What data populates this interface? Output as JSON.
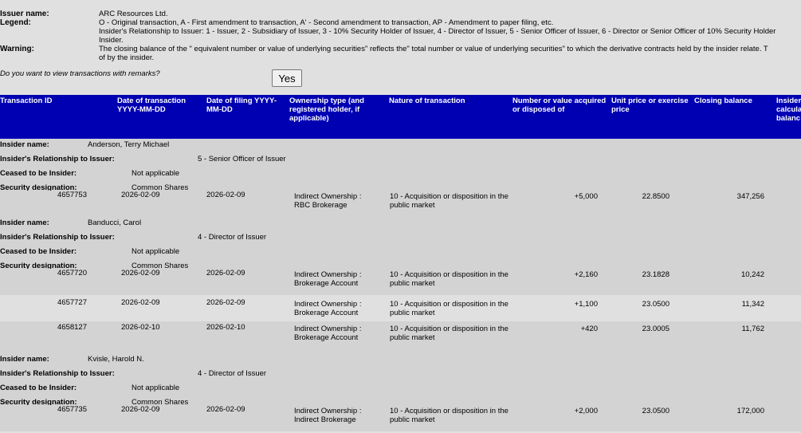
{
  "header": {
    "issuer_label": "Issuer name:",
    "issuer_value": "ARC Resources Ltd.",
    "legend_label": "Legend:",
    "legend_line1": "O - Original transaction, A - First amendment to transaction, A' - Second amendment to transaction, AP - Amendment to paper filing, etc.",
    "legend_line2": "Insider's Relationship to Issuer: 1 - Issuer, 2 - Subsidiary of Issuer, 3 - 10% Security Holder of Issuer, 4 - Director of Issuer, 5 - Senior Officer of Issuer, 6 - Director or Senior Officer of 10% Security Holder",
    "legend_line3": "Insider.",
    "warning_label": "Warning:",
    "warning_line1": "The closing balance of the \" equivalent number or value of underlying securities\" reflects the\" total number or value of underlying securities\" to which the derivative contracts held by the insider relate. T",
    "warning_line2": "of by the insider.",
    "remarks_question": "Do you want to view transactions with remarks?",
    "yes_button": "Yes"
  },
  "columns": [
    "Transaction ID",
    "Date of transaction YYYY-MM-DD",
    "Date of filing YYYY-MM-DD",
    "Ownership type (and registered holder, if applicable)",
    "Nature of transaction",
    "Number or value acquired or disposed of",
    "Unit price or exercise price",
    "Closing balance",
    "Insider calcula balanc"
  ],
  "labels": {
    "insider_name": "Insider name:",
    "relationship": "Insider's Relationship to Issuer:",
    "ceased": "Ceased to be Insider:",
    "security": "Security designation:"
  },
  "insiders": [
    {
      "name": "Anderson, Terry Michael",
      "relationship": "5 - Senior Officer of Issuer",
      "ceased": "Not applicable",
      "security": "Common Shares",
      "transactions": [
        {
          "id": "4657753",
          "date": "2026-02-09",
          "filing": "2026-02-09",
          "own1": "Indirect Ownership :",
          "own2": "RBC Brokerage",
          "nat1": "10 - Acquisition or disposition in the",
          "nat2": "public market",
          "qty": "+5,000",
          "price": "22.8500",
          "bal": "347,256"
        }
      ]
    },
    {
      "name": "Banducci, Carol",
      "relationship": "4 - Director of Issuer",
      "ceased": "Not applicable",
      "security": "Common Shares",
      "transactions": [
        {
          "id": "4657720",
          "date": "2026-02-09",
          "filing": "2026-02-09",
          "own1": "Indirect Ownership :",
          "own2": "Brokerage Account",
          "nat1": "10 - Acquisition or disposition in the",
          "nat2": "public market",
          "qty": "+2,160",
          "price": "23.1828",
          "bal": "10,242"
        },
        {
          "id": "4657727",
          "date": "2026-02-09",
          "filing": "2026-02-09",
          "own1": "Indirect Ownership :",
          "own2": "Brokerage Account",
          "nat1": "10 - Acquisition or disposition in the",
          "nat2": "public market",
          "qty": "+1,100",
          "price": "23.0500",
          "bal": "11,342"
        },
        {
          "id": "4658127",
          "date": "2026-02-10",
          "filing": "2026-02-10",
          "own1": "Indirect Ownership :",
          "own2": "Brokerage Account",
          "nat1": "10 - Acquisition or disposition in the",
          "nat2": "public market",
          "qty": "+420",
          "price": "23.0005",
          "bal": "11,762"
        }
      ]
    },
    {
      "name": "Kvisle, Harold N.",
      "relationship": "4 - Director of Issuer",
      "ceased": "Not applicable",
      "security": "Common Shares",
      "transactions": [
        {
          "id": "4657735",
          "date": "2026-02-09",
          "filing": "2026-02-09",
          "own1": "Indirect Ownership :",
          "own2": "Indirect Brokerage",
          "nat1": "10 - Acquisition or disposition in the",
          "nat2": "public market",
          "qty": "+2,000",
          "price": "23.0500",
          "bal": "172,000"
        }
      ]
    }
  ]
}
